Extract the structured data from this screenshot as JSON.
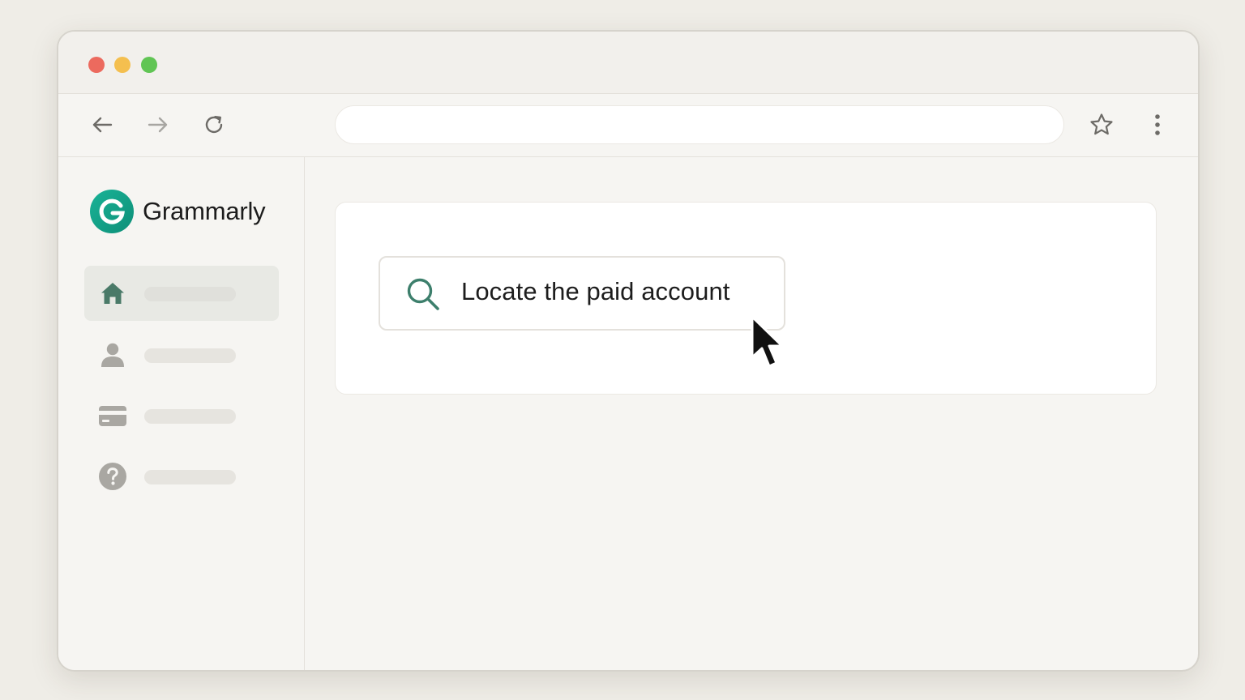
{
  "window": {
    "controls": [
      {
        "name": "close",
        "color": "#ec6a5e"
      },
      {
        "name": "minimize",
        "color": "#f4bf4f"
      },
      {
        "name": "maximize",
        "color": "#61c554"
      }
    ]
  },
  "toolbar": {
    "back_icon": "arrow-left-icon",
    "forward_icon": "arrow-right-icon",
    "reload_icon": "reload-icon",
    "address_value": "",
    "bookmark_icon": "star-icon",
    "menu_icon": "kebab-menu-icon"
  },
  "brand": {
    "name": "Grammarly",
    "logo_letter": "G",
    "color": "#15a68a"
  },
  "sidebar": {
    "items": [
      {
        "icon": "home-icon",
        "active": true
      },
      {
        "icon": "user-icon",
        "active": false
      },
      {
        "icon": "credit-card-icon",
        "active": false
      },
      {
        "icon": "help-icon",
        "active": false
      }
    ]
  },
  "search": {
    "value": "Locate the paid account",
    "icon": "search-icon"
  },
  "colors": {
    "accent": "#15a68a",
    "search_icon": "#3d7f6c",
    "home_icon": "#4a7a68",
    "inactive_icon": "#a9a7a2"
  }
}
